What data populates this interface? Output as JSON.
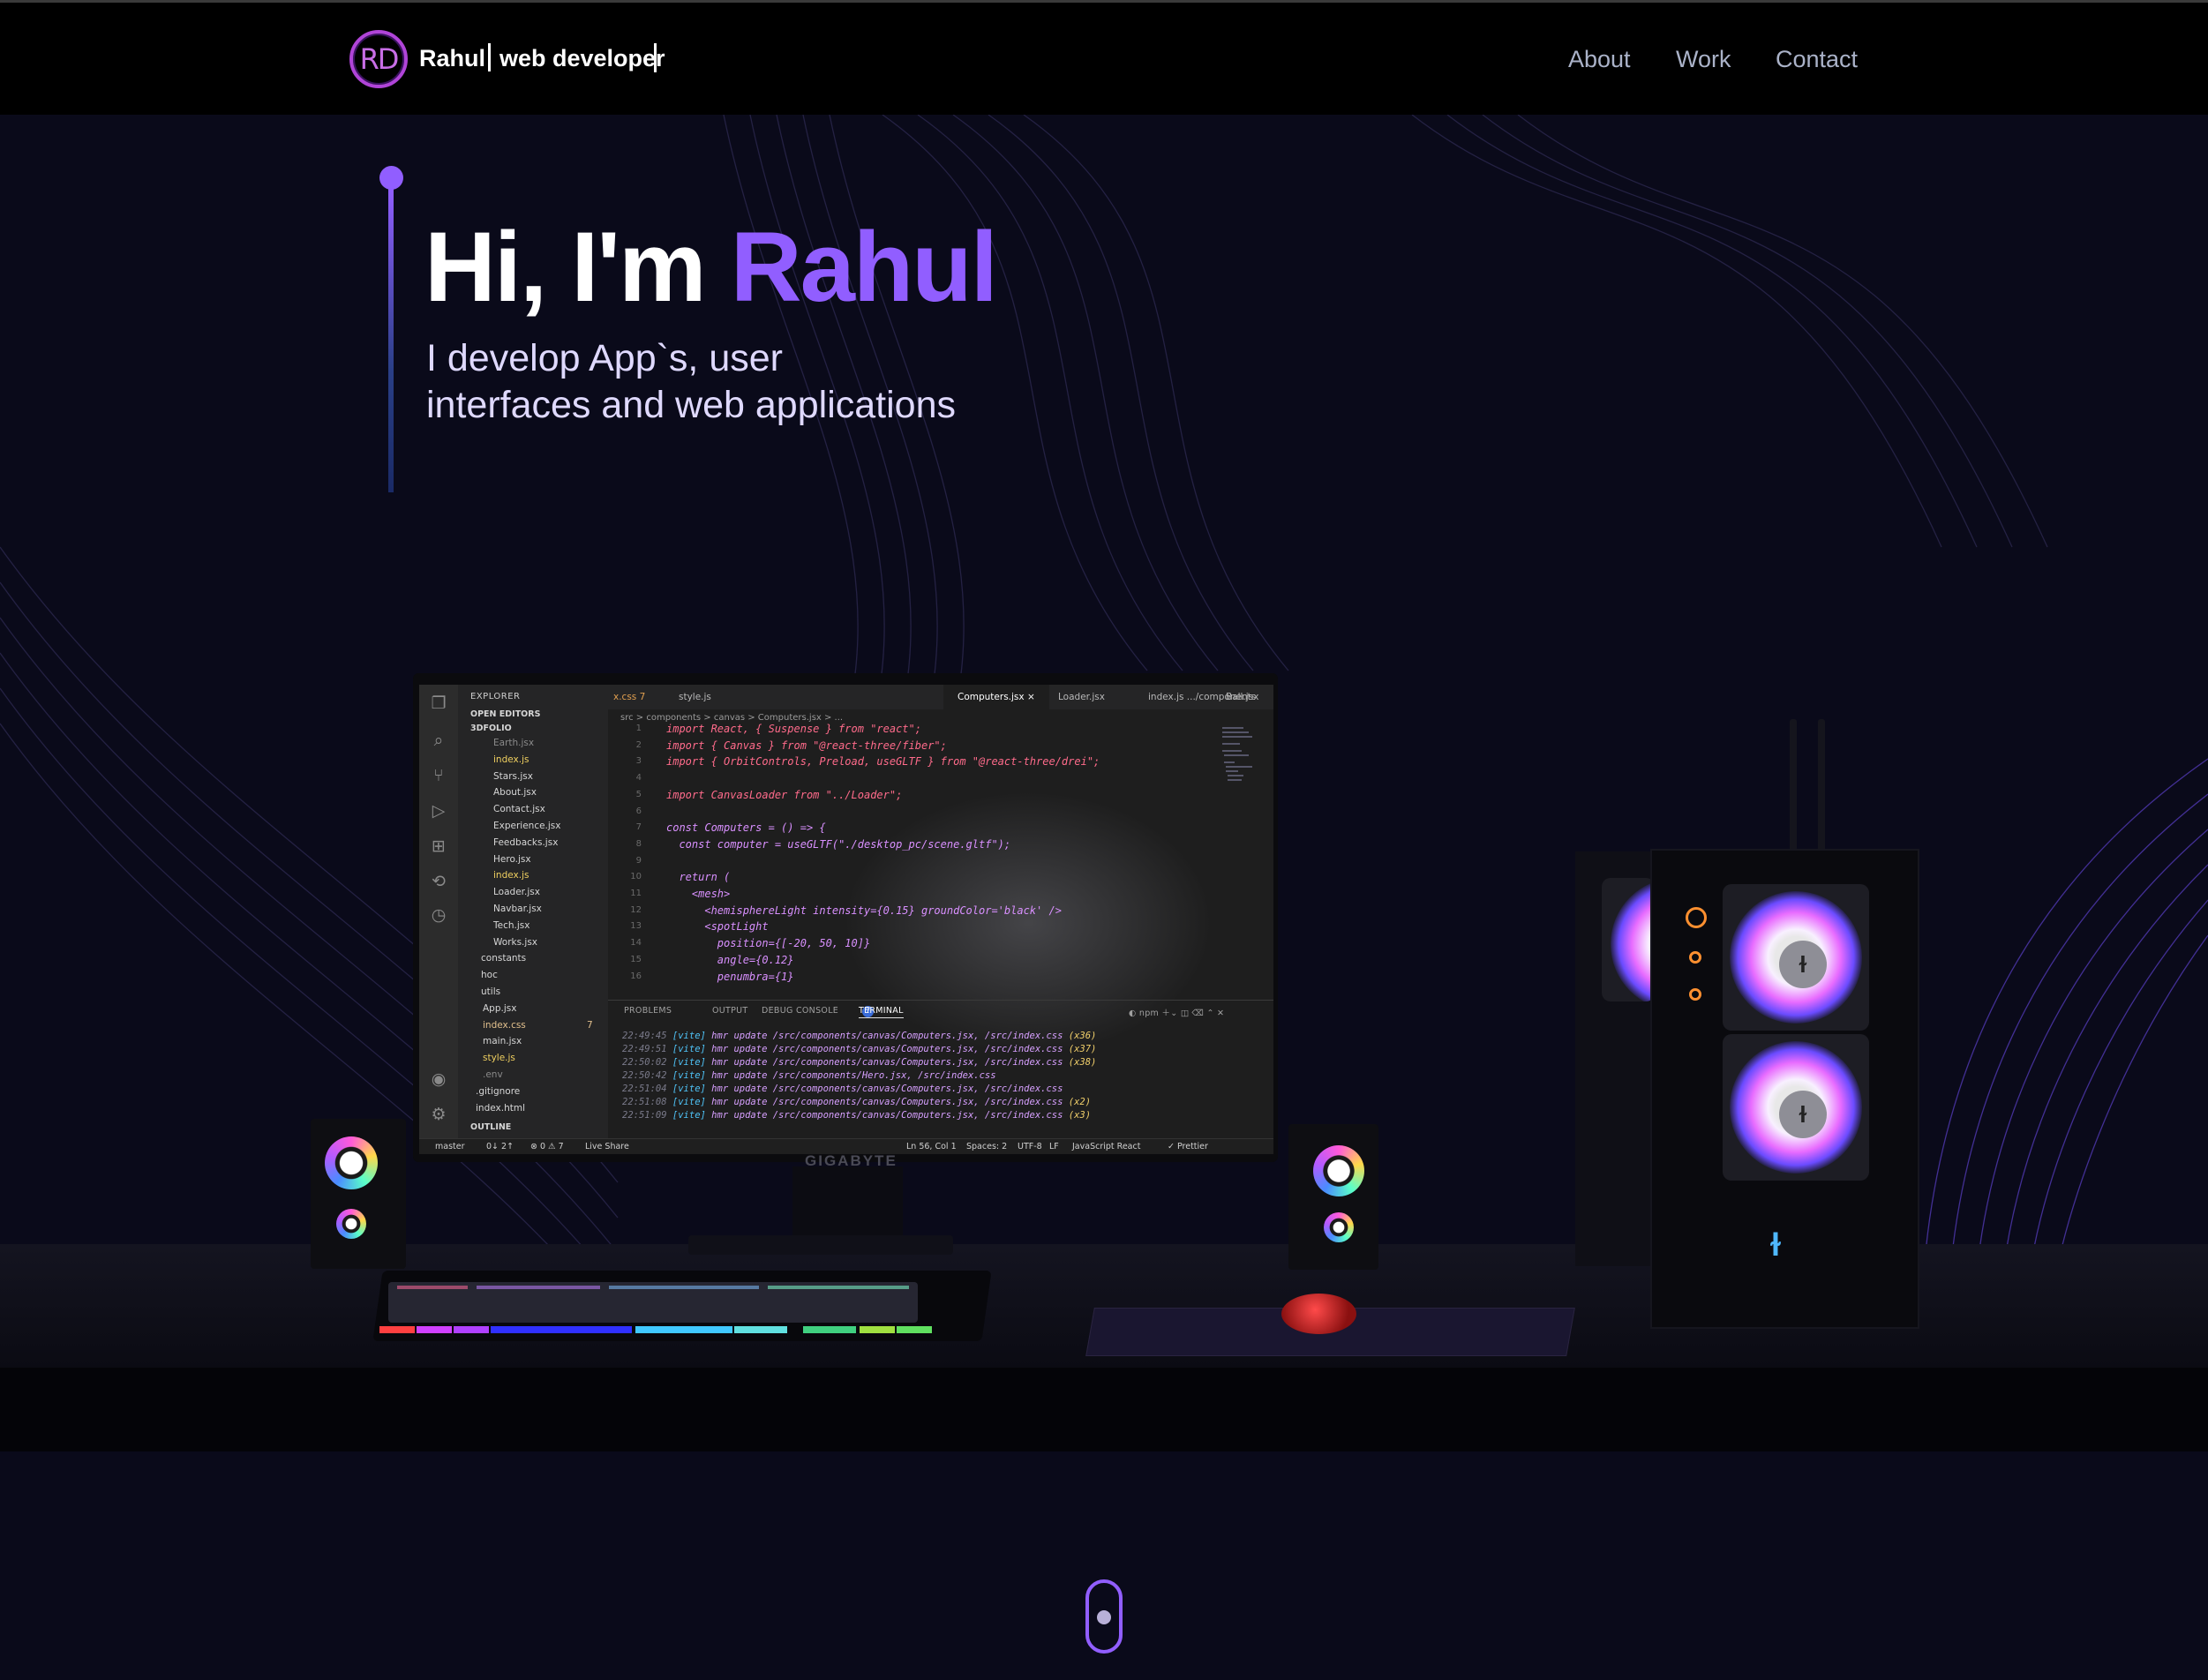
{
  "navbar": {
    "logo_text": "RD",
    "brand_name": "Rahul",
    "brand_role": "web developer",
    "links": [
      {
        "label": "About"
      },
      {
        "label": "Work"
      },
      {
        "label": "Contact"
      }
    ]
  },
  "hero": {
    "title_prefix": "Hi, I'm ",
    "title_name": "Rahul",
    "subtitle_line1": "I develop App`s, user",
    "subtitle_line2": "interfaces and web applications"
  },
  "colors": {
    "accent": "#915eff",
    "background": "#0a0a1a",
    "nav_bg": "#000000",
    "nav_link": "#aab2c8"
  },
  "monitor": {
    "brand": "GIGABYTE",
    "vscode": {
      "explorer_title": "EXPLORER",
      "open_editors": "OPEN EDITORS",
      "project": "3DFOLIO",
      "files": [
        {
          "name": "Earth.jsx",
          "kind": "dim"
        },
        {
          "name": "index.js",
          "kind": "js"
        },
        {
          "name": "Stars.jsx",
          "kind": "react"
        },
        {
          "name": "About.jsx",
          "kind": "react"
        },
        {
          "name": "Contact.jsx",
          "kind": "react"
        },
        {
          "name": "Experience.jsx",
          "kind": "react"
        },
        {
          "name": "Feedbacks.jsx",
          "kind": "react"
        },
        {
          "name": "Hero.jsx",
          "kind": "react"
        },
        {
          "name": "index.js",
          "kind": "js"
        },
        {
          "name": "Loader.jsx",
          "kind": "react"
        },
        {
          "name": "Navbar.jsx",
          "kind": "react"
        },
        {
          "name": "Tech.jsx",
          "kind": "react"
        },
        {
          "name": "Works.jsx",
          "kind": "react"
        },
        {
          "name": "constants",
          "kind": "folder"
        },
        {
          "name": "hoc",
          "kind": "folder"
        },
        {
          "name": "utils",
          "kind": "folder"
        },
        {
          "name": "App.jsx",
          "kind": "react"
        },
        {
          "name": "index.css",
          "kind": "hl"
        },
        {
          "name": "main.jsx",
          "kind": "react"
        },
        {
          "name": "style.js",
          "kind": "js"
        },
        {
          "name": ".env",
          "kind": "dim"
        },
        {
          "name": ".gitignore",
          "kind": "file"
        },
        {
          "name": "index.html",
          "kind": "file"
        }
      ],
      "outline": "OUTLINE",
      "index_css_badge": "7",
      "tabs": [
        {
          "label": "x.css 7"
        },
        {
          "label": "style.js"
        },
        {
          "label": "Computers.jsx ×"
        },
        {
          "label": "Loader.jsx"
        },
        {
          "label": "index.js  .../components"
        },
        {
          "label": "Ball.jsx"
        }
      ],
      "breadcrumbs": "src > components > canvas > Computers.jsx > ...",
      "code_lines": [
        {
          "n": "1",
          "text": "import React, { Suspense } from \"react\";"
        },
        {
          "n": "2",
          "text": "import { Canvas } from \"@react-three/fiber\";"
        },
        {
          "n": "3",
          "text": "import { OrbitControls, Preload, useGLTF } from \"@react-three/drei\";"
        },
        {
          "n": "4",
          "text": ""
        },
        {
          "n": "5",
          "text": "import CanvasLoader from \"../Loader\";"
        },
        {
          "n": "6",
          "text": ""
        },
        {
          "n": "7",
          "text": "const Computers = () => {"
        },
        {
          "n": "8",
          "text": "  const computer = useGLTF(\"./desktop_pc/scene.gltf\");"
        },
        {
          "n": "9",
          "text": ""
        },
        {
          "n": "10",
          "text": "  return ("
        },
        {
          "n": "11",
          "text": "    <mesh>"
        },
        {
          "n": "12",
          "text": "      <hemisphereLight intensity={0.15} groundColor='black' />"
        },
        {
          "n": "13",
          "text": "      <spotLight"
        },
        {
          "n": "14",
          "text": "        position={[-20, 50, 10]}"
        },
        {
          "n": "15",
          "text": "        angle={0.12}"
        },
        {
          "n": "16",
          "text": "        penumbra={1}"
        }
      ],
      "panel_tabs": [
        "PROBLEMS",
        "OUTPUT",
        "DEBUG CONSOLE",
        "TERMINAL"
      ],
      "problems_badge": "7",
      "terminal_lines": [
        {
          "time": "22:49:45",
          "text": "hmr update /src/components/canvas/Computers.jsx, /src/index.css",
          "count": "(x36)"
        },
        {
          "time": "22:49:51",
          "text": "hmr update /src/components/canvas/Computers.jsx, /src/index.css",
          "count": "(x37)"
        },
        {
          "time": "22:50:02",
          "text": "hmr update /src/components/canvas/Computers.jsx, /src/index.css",
          "count": "(x38)"
        },
        {
          "time": "22:50:42",
          "text": "hmr update /src/components/Hero.jsx, /src/index.css",
          "count": ""
        },
        {
          "time": "22:51:04",
          "text": "hmr update /src/components/canvas/Computers.jsx, /src/index.css",
          "count": ""
        },
        {
          "time": "22:51:08",
          "text": "hmr update /src/components/canvas/Computers.jsx, /src/index.css",
          "count": "(x2)"
        },
        {
          "time": "22:51:09",
          "text": "hmr update /src/components/canvas/Computers.jsx, /src/index.css",
          "count": "(x3)"
        }
      ],
      "terminal_tag": "[vite]",
      "status": {
        "branch": "master",
        "sync": "0↓ 2↑",
        "problems": "⊗ 0 ⚠ 7",
        "liveshare": "Live Share",
        "position": "Ln 56, Col 1",
        "spaces": "Spaces: 2",
        "encoding": "UTF-8",
        "eol": "LF",
        "language": "JavaScript React",
        "prettier": "✓ Prettier"
      }
    }
  },
  "scroll_indicator": {
    "icon": "scroll-mouse-icon"
  }
}
